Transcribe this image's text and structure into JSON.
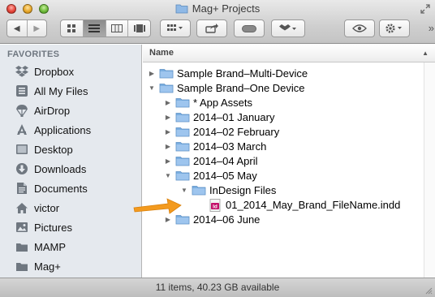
{
  "window": {
    "title": "Mag+ Projects",
    "status": "11 items, 40.23 GB available",
    "accent": "#3b8fe0"
  },
  "toolbar": {
    "back_icon": "chevron-left-icon",
    "forward_icon": "chevron-right-icon",
    "view_modes": [
      "icon-view-icon",
      "list-view-icon",
      "column-view-icon",
      "coverflow-view-icon"
    ],
    "active_view": "list-view-icon",
    "arrange_icon": "arrange-grid-icon",
    "share_icon": "share-icon",
    "tags_icon": "tag-pill-icon",
    "dropbox_icon": "dropbox-icon",
    "quicklook_icon": "eye-icon",
    "action_icon": "gear-icon",
    "overflow_label": "»"
  },
  "sidebar": {
    "heading": "FAVORITES",
    "items": [
      {
        "label": "Dropbox",
        "icon": "dropbox-icon"
      },
      {
        "label": "All My Files",
        "icon": "all-files-icon"
      },
      {
        "label": "AirDrop",
        "icon": "airdrop-icon"
      },
      {
        "label": "Applications",
        "icon": "applications-icon"
      },
      {
        "label": "Desktop",
        "icon": "desktop-icon"
      },
      {
        "label": "Downloads",
        "icon": "downloads-icon"
      },
      {
        "label": "Documents",
        "icon": "documents-icon"
      },
      {
        "label": "victor",
        "icon": "home-icon"
      },
      {
        "label": "Pictures",
        "icon": "pictures-icon"
      },
      {
        "label": "MAMP",
        "icon": "folder-icon"
      },
      {
        "label": "Mag+",
        "icon": "folder-icon"
      }
    ]
  },
  "list": {
    "column_name": "Name",
    "sort_indicator": "▲",
    "rows": [
      {
        "label": "Sample Brand–Multi-Device",
        "depth": 0,
        "disclosure": "closed",
        "kind": "folder"
      },
      {
        "label": "Sample Brand–One Device",
        "depth": 0,
        "disclosure": "open",
        "kind": "folder"
      },
      {
        "label": "* App Assets",
        "depth": 1,
        "disclosure": "closed",
        "kind": "folder"
      },
      {
        "label": "2014–01 January",
        "depth": 1,
        "disclosure": "closed",
        "kind": "folder"
      },
      {
        "label": "2014–02 February",
        "depth": 1,
        "disclosure": "closed",
        "kind": "folder"
      },
      {
        "label": "2014–03 March",
        "depth": 1,
        "disclosure": "closed",
        "kind": "folder"
      },
      {
        "label": "2014–04 April",
        "depth": 1,
        "disclosure": "closed",
        "kind": "folder"
      },
      {
        "label": "2014–05 May",
        "depth": 1,
        "disclosure": "open",
        "kind": "folder"
      },
      {
        "label": "InDesign Files",
        "depth": 2,
        "disclosure": "open",
        "kind": "folder"
      },
      {
        "label": "01_2014_May_Brand_FileName.indd",
        "depth": 3,
        "disclosure": "none",
        "kind": "indd"
      },
      {
        "label": "2014–06 June",
        "depth": 1,
        "disclosure": "closed",
        "kind": "folder"
      }
    ],
    "indd_badge": "Id",
    "indd_color": "#c3116a",
    "folder_color": "#7aaee0"
  },
  "annotation": {
    "arrow_icon": "orange-arrow-icon",
    "arrow_color": "#f39a1e"
  }
}
